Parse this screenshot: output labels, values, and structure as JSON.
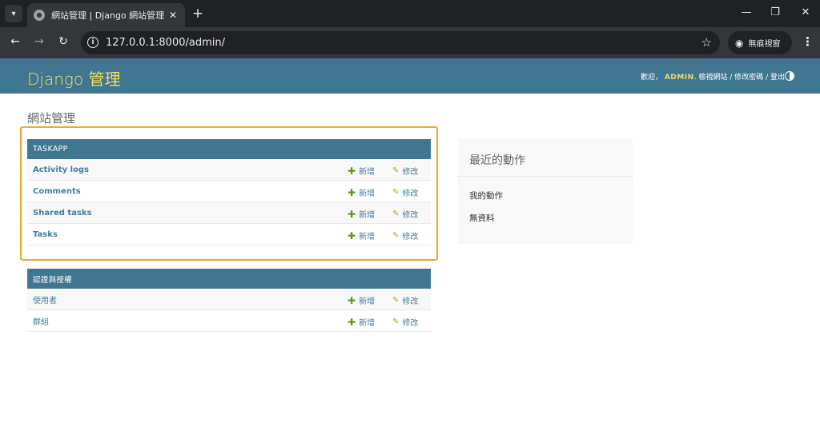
{
  "browser": {
    "tab_title": "網站管理 | Django 網站管理",
    "url": "127.0.0.1:8000/admin/",
    "incognito_label": "無痕視窗"
  },
  "header": {
    "brand": "Django 管理",
    "welcome": "歡迎，",
    "username": "ADMIN",
    "view_site": "檢視網站",
    "change_password": "修改密碼",
    "logout": "登出",
    "separator": "/"
  },
  "page": {
    "title": "網站管理"
  },
  "modules": [
    {
      "caption": "TASKAPP",
      "models": [
        {
          "name": "Activity logs",
          "add": "新增",
          "change": "修改"
        },
        {
          "name": "Comments",
          "add": "新增",
          "change": "修改"
        },
        {
          "name": "Shared tasks",
          "add": "新增",
          "change": "修改"
        },
        {
          "name": "Tasks",
          "add": "新增",
          "change": "修改"
        }
      ]
    },
    {
      "caption": "認證與授權",
      "models": [
        {
          "name": "使用者",
          "add": "新增",
          "change": "修改"
        },
        {
          "name": "群組",
          "add": "新增",
          "change": "修改"
        }
      ]
    }
  ],
  "recent_actions": {
    "title": "最近的動作",
    "my_actions": "我的動作",
    "empty": "無資料"
  },
  "colors": {
    "header_bg": "#417690",
    "brand_yellow": "#f5dd5d",
    "link": "#447e9b",
    "add_green": "#5b9a19",
    "change_yellow": "#c8a016",
    "highlight_border": "#f5a623"
  },
  "icons": {
    "add": "plus-icon",
    "change": "pencil-icon"
  }
}
